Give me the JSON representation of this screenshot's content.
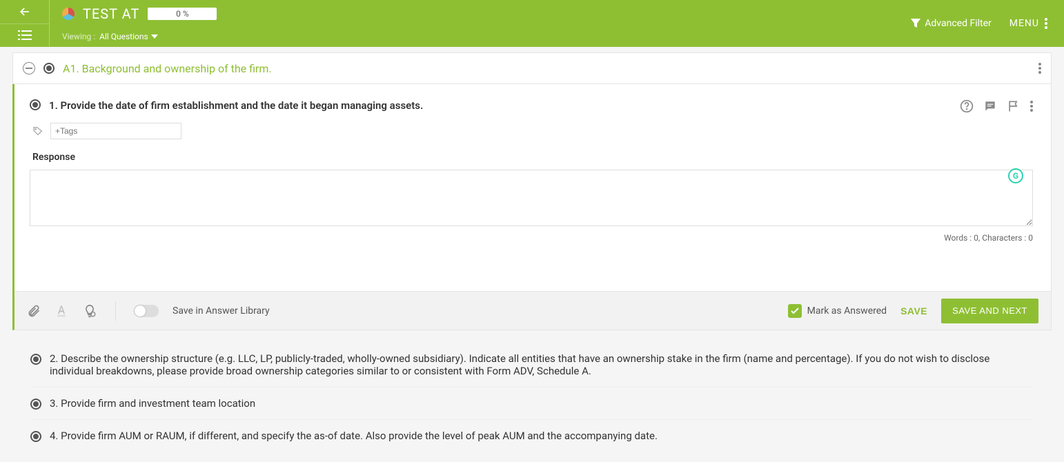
{
  "header": {
    "app_title": "TEST AT",
    "progress_text": "0 %",
    "viewing_label": "Viewing :",
    "viewing_value": "All Questions",
    "advanced_filter": "Advanced Filter",
    "menu_label": "MENU"
  },
  "section": {
    "title": "A1. Background and ownership of the firm."
  },
  "question": {
    "text": "1. Provide the date of firm establishment and the date it began managing assets.",
    "tags_placeholder": "+Tags",
    "response_label": "Response",
    "words": 0,
    "characters": 0,
    "counter_text": "Words : 0, Characters : 0"
  },
  "toolbar": {
    "save_in_library": "Save in Answer Library",
    "mark_as_answered": "Mark as Answered",
    "save": "SAVE",
    "save_and_next": "SAVE AND NEXT"
  },
  "other_questions": [
    {
      "text": "2. Describe the ownership structure (e.g. LLC, LP, publicly-traded, wholly-owned subsidiary). Indicate all entities that have an ownership stake in the firm (name and percentage). If you do not wish to disclose individual breakdowns, please provide broad ownership categories similar to or consistent with Form ADV, Schedule A."
    },
    {
      "text": "3. Provide firm and investment team location"
    },
    {
      "text": "4. Provide firm AUM or RAUM, if different, and specify the as-of date. Also provide the level of peak AUM and the accompanying date."
    }
  ]
}
